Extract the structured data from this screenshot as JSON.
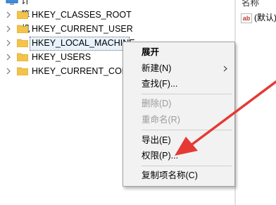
{
  "tree": {
    "root_label": "计算机",
    "items": [
      {
        "label": "HKEY_CLASSES_ROOT"
      },
      {
        "label": "HKEY_CURRENT_USER"
      },
      {
        "label": "HKEY_LOCAL_MACHINE"
      },
      {
        "label": "HKEY_USERS"
      },
      {
        "label": "HKEY_CURRENT_CON"
      }
    ]
  },
  "right_pane": {
    "column_name": "名称",
    "value_label": "(默认)"
  },
  "context_menu": {
    "items": [
      {
        "label": "展开"
      },
      {
        "label": "新建(N)"
      },
      {
        "label": "查找(F)..."
      },
      {
        "label": "删除(D)"
      },
      {
        "label": "重命名(R)"
      },
      {
        "label": "导出(E)"
      },
      {
        "label": "权限(P)..."
      },
      {
        "label": "复制项名称(C)"
      }
    ]
  },
  "colors": {
    "annotation_arrow": "#e53935",
    "folder": "#f3c34a",
    "menu_background": "#f2f2f2"
  }
}
